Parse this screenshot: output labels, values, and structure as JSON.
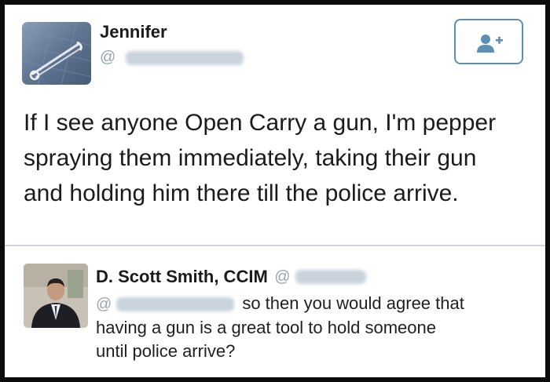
{
  "tweet": {
    "author_name": "Jennifer",
    "handle_at": "@",
    "icon": "follow-user-plus-icon",
    "text_lines": [
      "If I see anyone Open Carry a gun, I'm pepper",
      "spraying them immediately, taking their gun",
      "and holding him there till the police arrive."
    ]
  },
  "reply": {
    "author_name": "D. Scott Smith, CCIM",
    "handle_at": "@",
    "mention_at": "@",
    "text_first": "so then you would agree that",
    "text_lines": [
      "having a gun is a great tool to hold someone",
      "until police arrive?"
    ]
  },
  "colors": {
    "follow_border": "#5d8fb2",
    "handle_gray": "#9aa4ad",
    "divider": "#d2d6da"
  }
}
